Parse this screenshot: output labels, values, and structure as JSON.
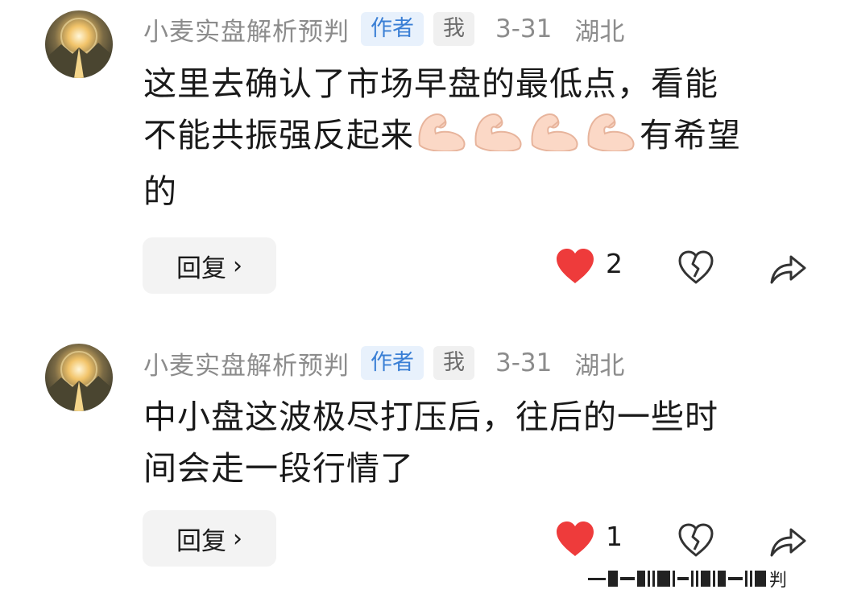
{
  "comments": [
    {
      "username": "小麦实盘解析预判",
      "badge_author": "作者",
      "badge_me": "我",
      "date": "3-31",
      "location": "湖北",
      "text_line1": "这里去确认了市场早盘的最低点，看能",
      "text_line2_pre": "不能共振强反起来",
      "emoji": "flexed-biceps-emoji",
      "emoji_count": 4,
      "text_line2_post": "有希望",
      "text_line3": "的",
      "reply_label": "回复",
      "reply_chevron": "›",
      "likes": "2",
      "liked": true
    },
    {
      "username": "小麦实盘解析预判",
      "badge_author": "作者",
      "badge_me": "我",
      "date": "3-31",
      "location": "湖北",
      "text_line1": "中小盘这波极尽打压后，往后的一些时",
      "text_line2": "间会走一段行情了",
      "reply_label": "回复",
      "reply_chevron": "›",
      "likes": "1",
      "liked": true
    }
  ],
  "watermark": {
    "text": "判"
  },
  "colors": {
    "like_red": "#ee3b3b",
    "author_badge_bg": "#e8f1fc",
    "author_badge_text": "#3a7fd5",
    "meta_gray": "#8c8c8c"
  }
}
